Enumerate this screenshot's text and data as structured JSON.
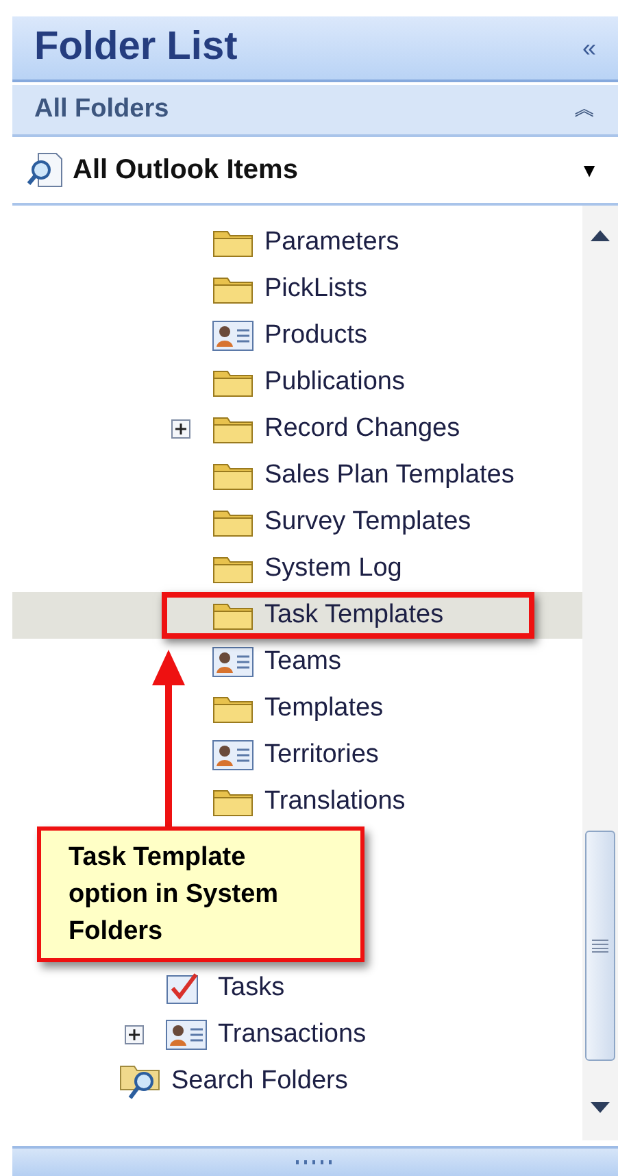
{
  "pane": {
    "title": "Folder List",
    "collapse_glyph": "«"
  },
  "section": {
    "title": "All Folders",
    "collapse_glyph": "︽"
  },
  "view_selector": {
    "label": "All Outlook Items",
    "dropdown_glyph": "▼"
  },
  "tree": [
    {
      "children": [
        {
          "children": [
            {
              "label": "Parameters",
              "kind": "folder",
              "expandable": false,
              "selected": false
            },
            {
              "label": "PickLists",
              "kind": "folder",
              "expandable": false,
              "selected": false
            },
            {
              "label": "Products",
              "kind": "contacts",
              "expandable": false,
              "selected": false
            },
            {
              "label": "Publications",
              "kind": "folder",
              "expandable": false,
              "selected": false
            },
            {
              "label": "Record Changes",
              "kind": "folder",
              "expandable": true,
              "selected": false
            },
            {
              "label": "Sales Plan Templates",
              "kind": "folder",
              "expandable": false,
              "selected": false
            },
            {
              "label": "Survey Templates",
              "kind": "folder",
              "expandable": false,
              "selected": false
            },
            {
              "label": "System Log",
              "kind": "folder",
              "expandable": false,
              "selected": false
            },
            {
              "label": "Task Templates",
              "kind": "folder",
              "expandable": false,
              "selected": true
            },
            {
              "label": "Teams",
              "kind": "contacts",
              "expandable": false,
              "selected": false
            },
            {
              "label": "Templates",
              "kind": "folder",
              "expandable": false,
              "selected": false
            },
            {
              "label": "Territories",
              "kind": "contacts",
              "expandable": false,
              "selected": false
            },
            {
              "label": "Translations",
              "kind": "folder",
              "expandable": false,
              "selected": false
            }
          ]
        },
        {
          "label": "Tasks",
          "kind": "tasks",
          "expandable": false,
          "selected": false
        },
        {
          "label": "Transactions",
          "kind": "contacts",
          "expandable": true,
          "selected": false
        }
      ]
    },
    {
      "label": "Search Folders",
      "kind": "search-folder",
      "expandable": false,
      "selected": false
    }
  ],
  "callout": {
    "text": "Task Template option in System Folders"
  }
}
